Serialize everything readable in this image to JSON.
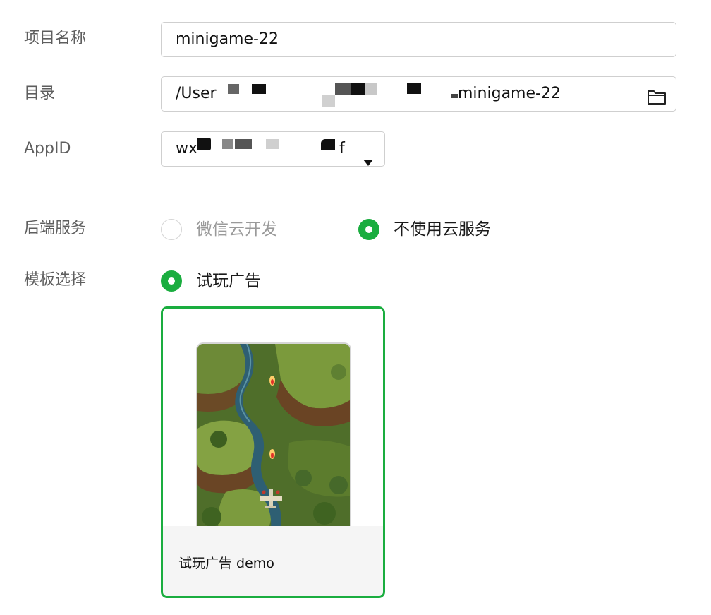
{
  "form": {
    "project_name": {
      "label": "项目名称",
      "value": "minigame-22"
    },
    "directory": {
      "label": "目录",
      "value_prefix": "/User",
      "value_suffix": "minigame-22",
      "icon": "folder-icon"
    },
    "appid": {
      "label": "AppID",
      "value_prefix": "wx",
      "value_suffix": "f",
      "icon": "caret-down-icon"
    },
    "backend": {
      "label": "后端服务",
      "options": [
        {
          "label": "微信云开发",
          "selected": false,
          "disabled": true
        },
        {
          "label": "不使用云服务",
          "selected": true,
          "disabled": false
        }
      ]
    },
    "template": {
      "label": "模板选择",
      "option": {
        "label": "试玩广告",
        "selected": true
      },
      "card": {
        "title": "试玩广告 demo"
      }
    }
  },
  "colors": {
    "accent": "#1aad3f",
    "label": "#5e5e5e",
    "border": "#cfcfcf"
  }
}
